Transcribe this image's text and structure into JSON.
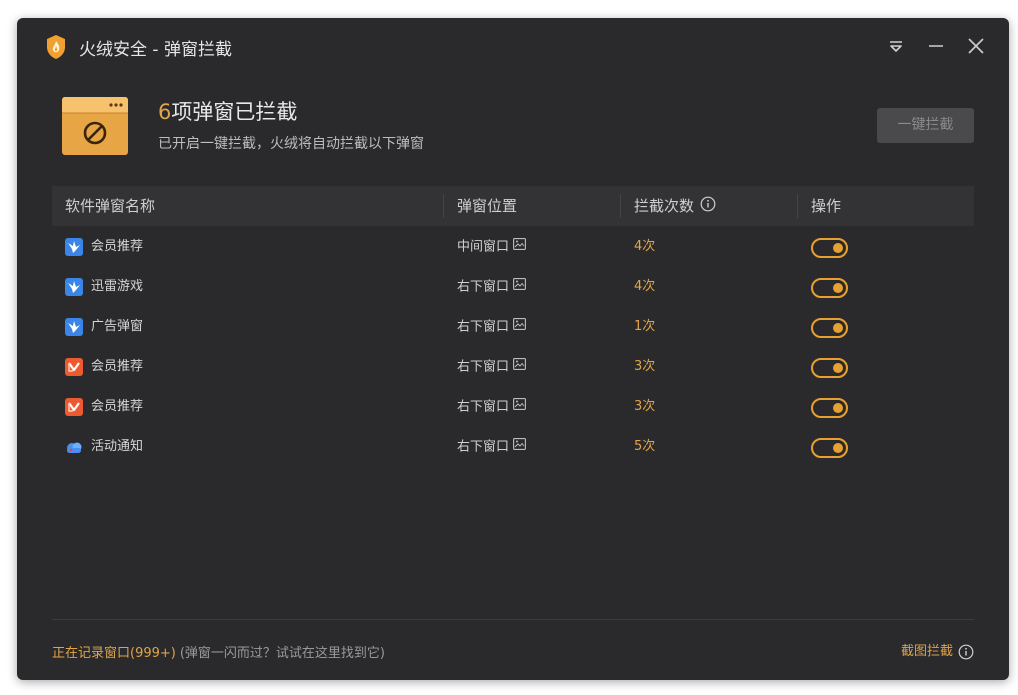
{
  "window": {
    "title": "火绒安全 - 弹窗拦截"
  },
  "header": {
    "count_num": "6",
    "count_text": "项弹窗已拦截",
    "subtitle": "已开启一键拦截，火绒将自动拦截以下弹窗",
    "one_click_label": "一键拦截"
  },
  "table": {
    "columns": {
      "name": "软件弹窗名称",
      "position": "弹窗位置",
      "count": "拦截次数",
      "operation": "操作"
    },
    "rows": [
      {
        "name": "会员推荐",
        "position": "中间窗口",
        "count": "4次",
        "app_icon": "xunlei-bird-icon",
        "enabled": true
      },
      {
        "name": "迅雷游戏",
        "position": "右下窗口",
        "count": "4次",
        "app_icon": "xunlei-bird-icon",
        "enabled": true
      },
      {
        "name": "广告弹窗",
        "position": "右下窗口",
        "count": "1次",
        "app_icon": "xunlei-bird-icon",
        "enabled": true
      },
      {
        "name": "会员推荐",
        "position": "右下窗口",
        "count": "3次",
        "app_icon": "wps-icon",
        "enabled": true
      },
      {
        "name": "会员推荐",
        "position": "右下窗口",
        "count": "3次",
        "app_icon": "wps-icon",
        "enabled": true
      },
      {
        "name": "活动通知",
        "position": "右下窗口",
        "count": "5次",
        "app_icon": "baidu-netdisk-icon",
        "enabled": true
      }
    ]
  },
  "footer": {
    "record_link": "正在记录窗口(999+)",
    "record_hint": "(弹窗一闪而过？试试在这里找到它)",
    "screenshot_block": "截图拦截"
  },
  "colors": {
    "accent": "#e0a44a",
    "toggle": "#e8a030",
    "background": "#2a2a2c",
    "header_row": "#333335"
  }
}
